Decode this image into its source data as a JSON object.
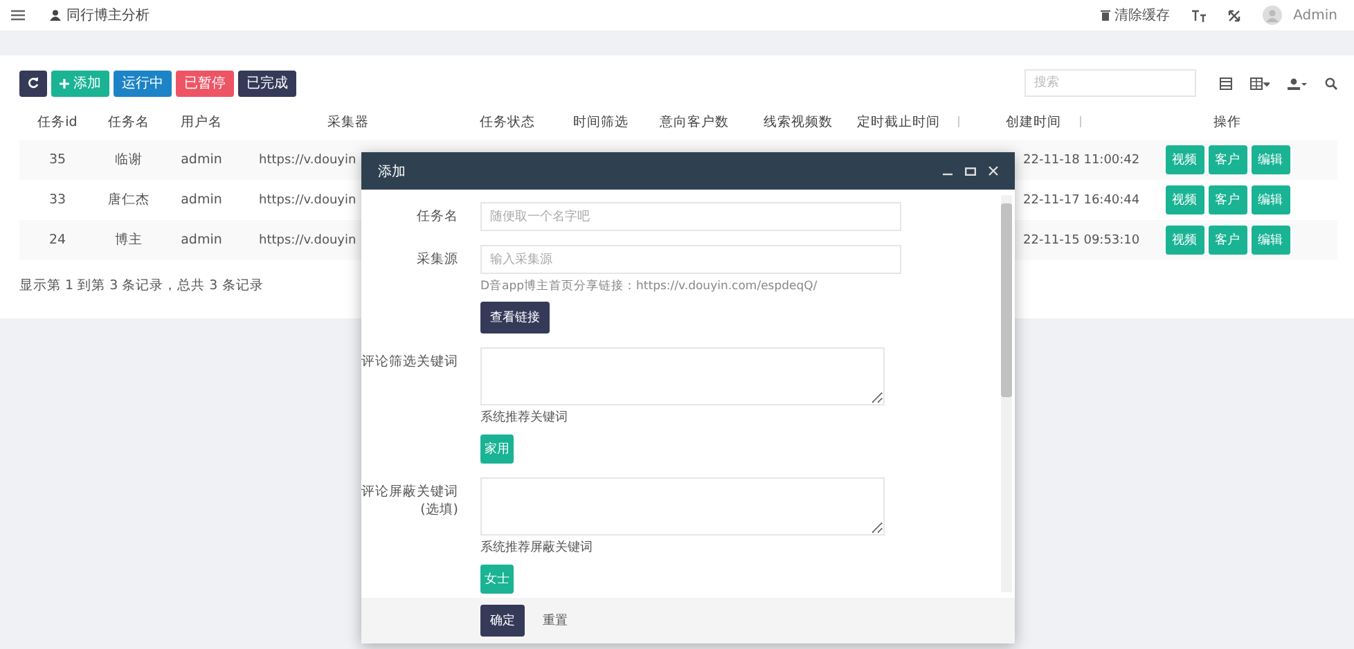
{
  "topbar": {
    "title": "同行博主分析",
    "clear_cache": "清除缓存",
    "user": "Admin"
  },
  "toolbar": {
    "buttons": [
      {
        "kind": "icon"
      },
      {
        "kind": "add",
        "label": "添加"
      },
      {
        "kind": "running",
        "label": "运行中"
      },
      {
        "kind": "paused",
        "label": "已暂停"
      },
      {
        "kind": "done",
        "label": "已完成"
      }
    ],
    "search": {
      "placeholder": "搜索"
    }
  },
  "table": {
    "columns": [
      {
        "label": "任务id",
        "sortable": false
      },
      {
        "label": "任务名",
        "sortable": false
      },
      {
        "label": "用户名",
        "sortable": false
      },
      {
        "label": "采集器",
        "sortable": false
      },
      {
        "label": "任务状态",
        "sortable": false
      },
      {
        "label": "时间筛选",
        "sortable": false
      },
      {
        "label": "意向客户数",
        "sortable": false
      },
      {
        "label": "线索视频数",
        "sortable": false
      },
      {
        "label": "定时截止时间",
        "sortable": true
      },
      {
        "label": "创建时间",
        "sortable": true
      },
      {
        "label": "操作",
        "sortable": false
      }
    ],
    "rows": [
      {
        "id": "35",
        "name": "临谢",
        "user": "admin",
        "source": "https://v.douyin",
        "created": "22-11-18 11:00:42",
        "actions": [
          "视频",
          "客户",
          "编辑"
        ]
      },
      {
        "id": "33",
        "name": "唐仁杰",
        "user": "admin",
        "source": "https://v.douyin",
        "created": "22-11-17 16:40:44",
        "actions": [
          "视频",
          "客户",
          "编辑"
        ]
      },
      {
        "id": "24",
        "name": "博主",
        "user": "admin",
        "source": "https://v.douyin",
        "created": "22-11-15 09:53:10",
        "actions": [
          "视频",
          "客户",
          "编辑"
        ]
      }
    ],
    "footer": "显示第 1 到第 3 条记录，总共 3 条记录"
  },
  "dialog": {
    "title": "添加",
    "fields": [
      {
        "kind": "input",
        "label": "任务名",
        "placeholder": "随便取一个名字吧"
      },
      {
        "kind": "input",
        "label": "采集源",
        "placeholder": "输入采集源",
        "hint": "D音app博主首页分享链接：https://v.douyin.com/espdeqQ/",
        "button": "查看链接"
      },
      {
        "kind": "textarea",
        "label": "评论筛选关键词",
        "recommend": "系统推荐关键词",
        "tag": "家用"
      },
      {
        "kind": "textarea",
        "label": "评论屏蔽关键词(选填)",
        "recommend": "系统推荐屏蔽关键词",
        "tag": "女士"
      }
    ],
    "buttons": [
      {
        "kind": "primary",
        "label": "确定"
      },
      {
        "kind": "plain",
        "label": "重置"
      }
    ]
  }
}
